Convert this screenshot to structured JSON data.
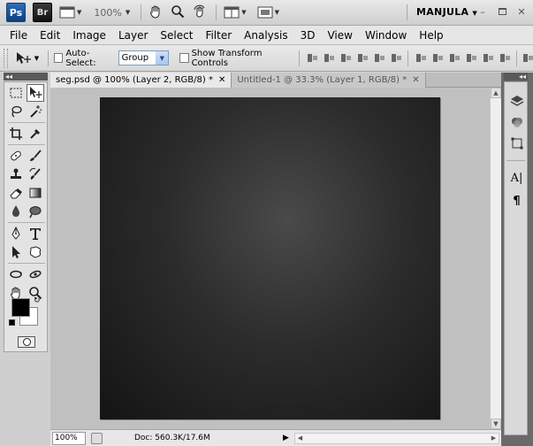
{
  "appbar": {
    "logo_ps": "Ps",
    "logo_br": "Br",
    "zoom": "100%",
    "workspace": "MANJULA"
  },
  "menu": [
    "File",
    "Edit",
    "Image",
    "Layer",
    "Select",
    "Filter",
    "Analysis",
    "3D",
    "View",
    "Window",
    "Help"
  ],
  "options": {
    "auto_select_label": "Auto-Select:",
    "auto_select_value": "Group",
    "show_transform_label": "Show Transform Controls"
  },
  "tabs": [
    {
      "label": "seg.psd @ 100% (Layer 2, RGB/8) *",
      "active": true
    },
    {
      "label": "Untitled-1 @ 33.3% (Layer 1, RGB/8) *",
      "active": false
    }
  ],
  "status": {
    "zoom": "100%",
    "doc": "Doc: 560.3K/17.6M"
  },
  "right_panel_text": {
    "char_icon": "A|",
    "para_icon": "¶"
  },
  "colors": {
    "foreground": "#000000",
    "background": "#ffffff",
    "accent_ps": "#1c5aa6"
  },
  "icons": [
    "move-tool-icon",
    "marquee-tool-icon",
    "lasso-tool-icon",
    "magic-wand-icon",
    "crop-tool-icon",
    "eyedropper-icon",
    "healing-brush-icon",
    "brush-tool-icon",
    "clone-stamp-icon",
    "history-brush-icon",
    "eraser-icon",
    "gradient-tool-icon",
    "blur-tool-icon",
    "dodge-tool-icon",
    "pen-tool-icon",
    "type-tool-icon",
    "path-selection-icon",
    "custom-shape-icon",
    "3d-rotate-icon",
    "3d-orbit-icon",
    "hand-tool-icon",
    "zoom-tool-icon"
  ]
}
